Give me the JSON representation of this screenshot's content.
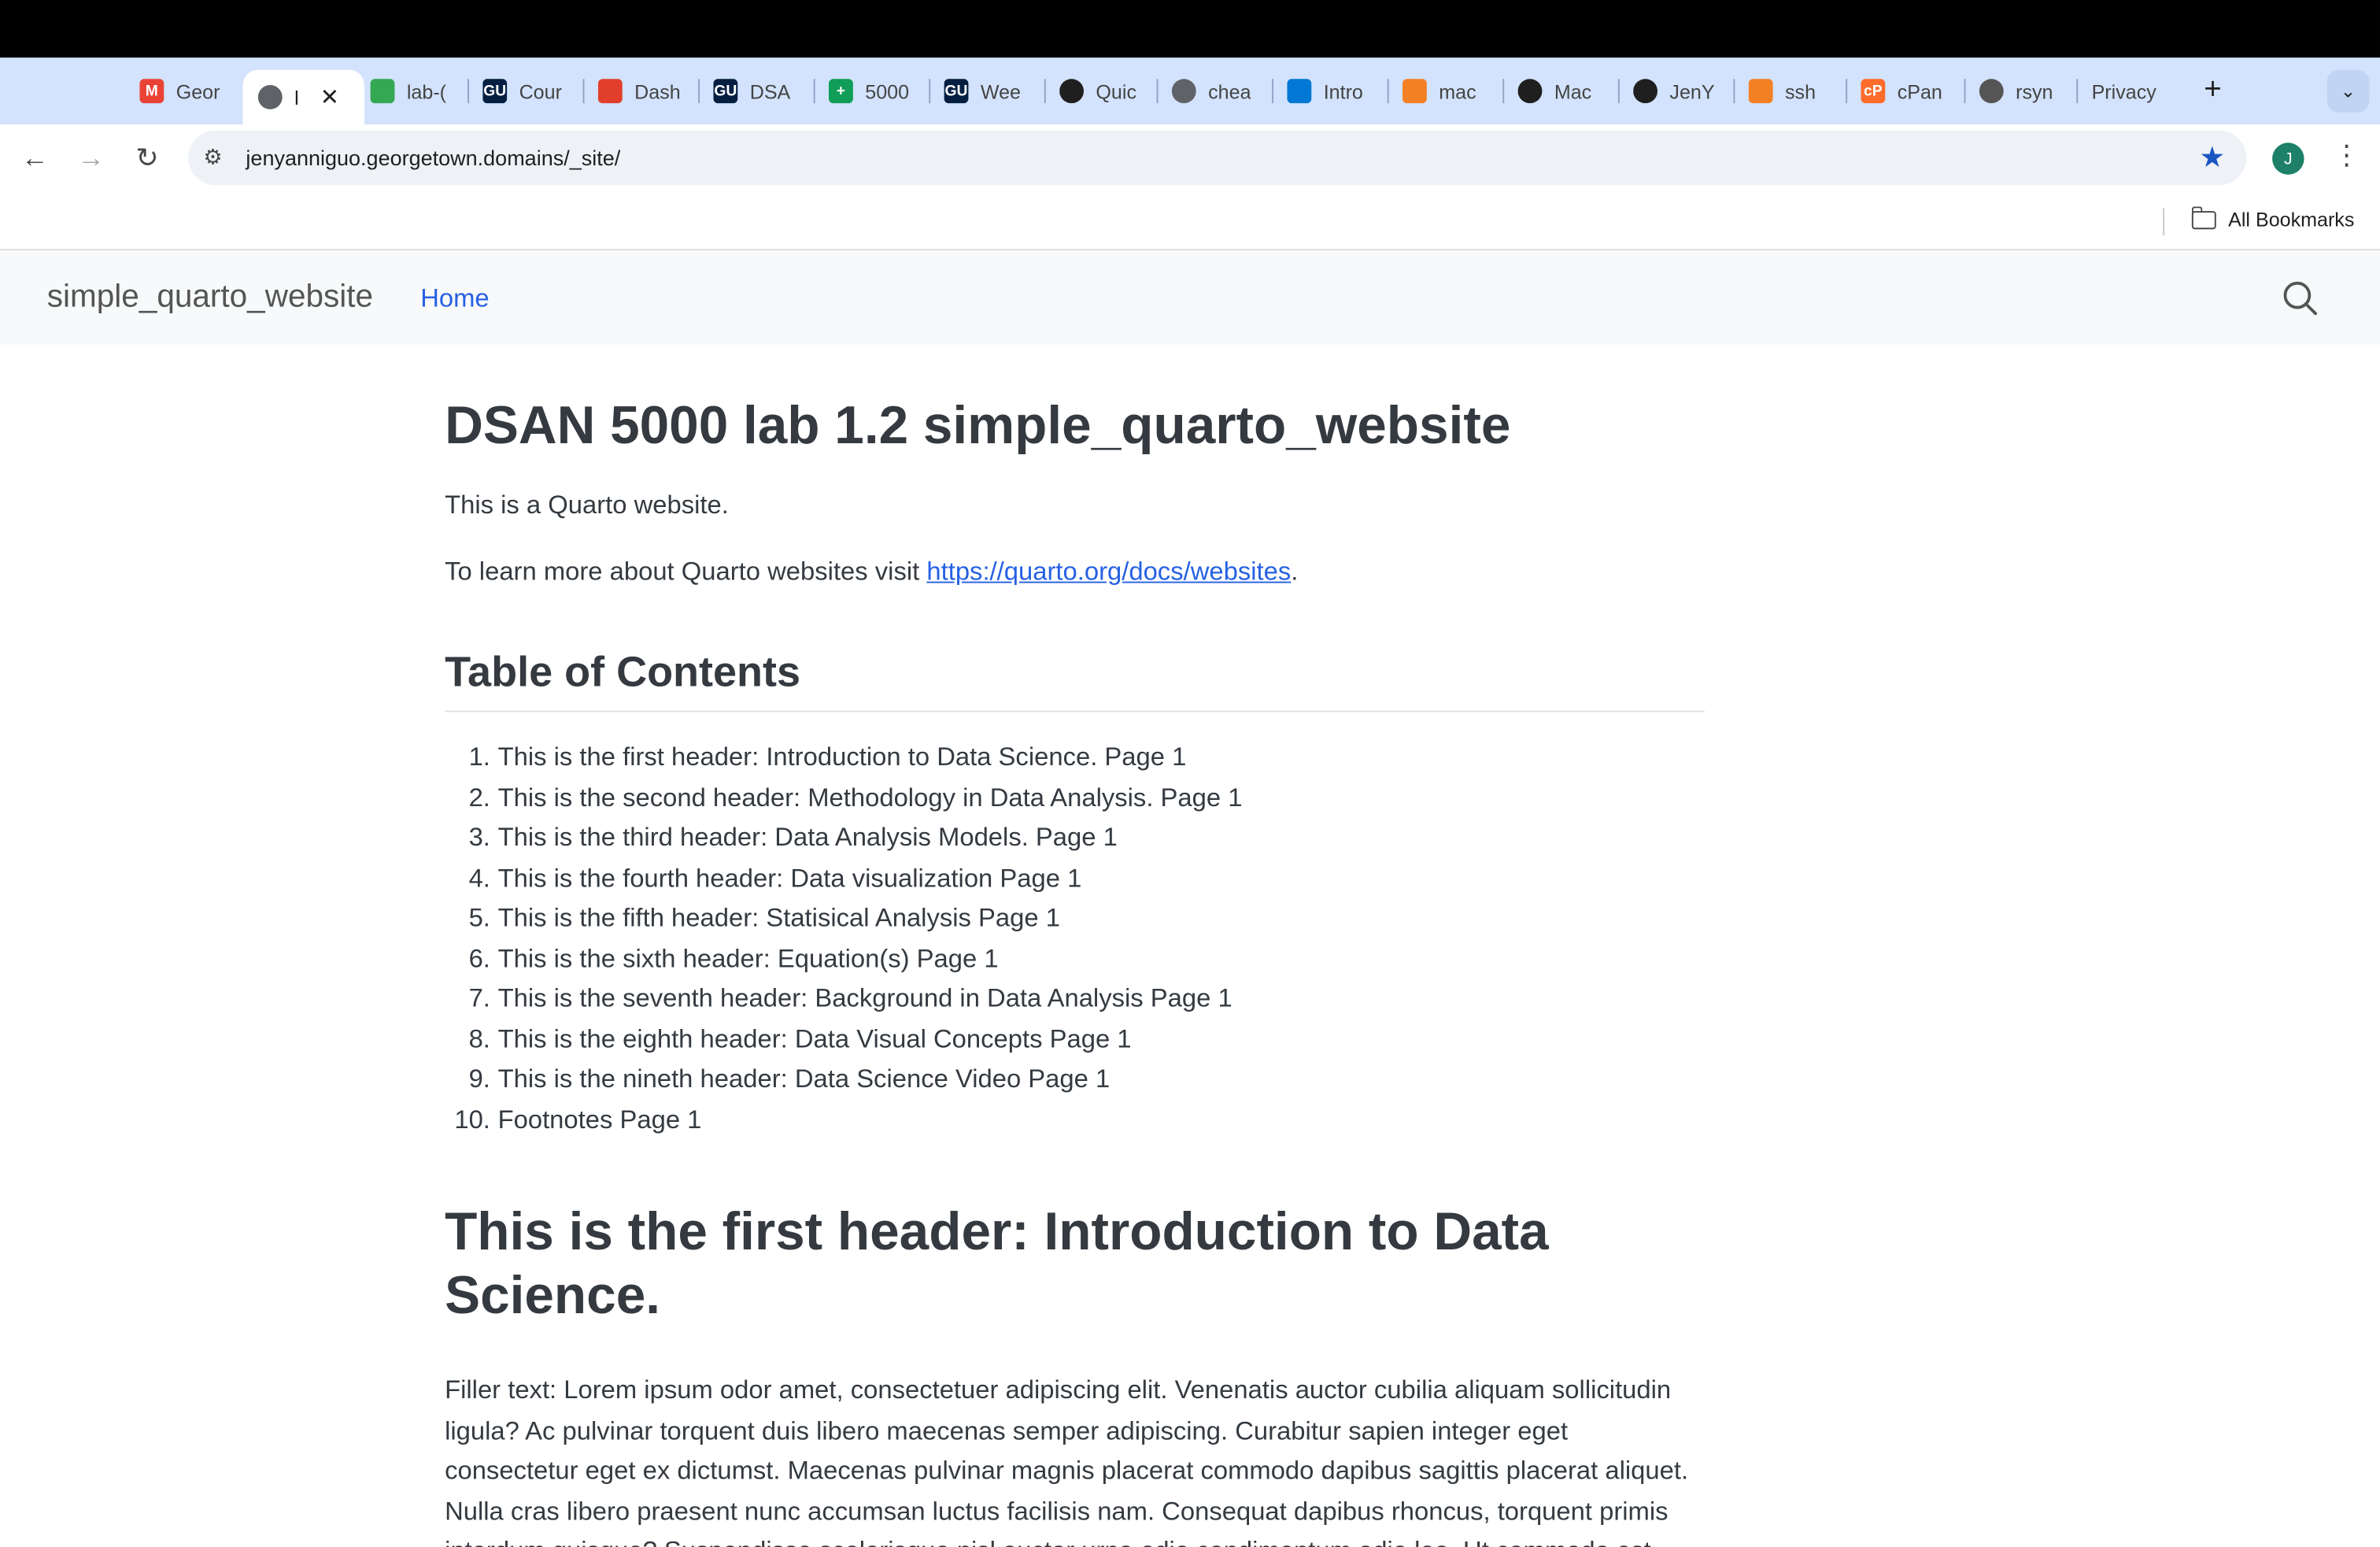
{
  "browser": {
    "tabs": [
      {
        "title": "Geor",
        "icon": "gmail-icon",
        "color": "#ea4335",
        "glyph": "M"
      },
      {
        "title": "l",
        "icon": "globe-icon",
        "color": "#5f6368",
        "glyph": "",
        "active": true
      },
      {
        "title": "lab-(",
        "icon": "google-drive-icon",
        "color": "#34a853",
        "glyph": ""
      },
      {
        "title": "Cour",
        "icon": "georgetown-icon",
        "color": "#041e42",
        "glyph": "GU"
      },
      {
        "title": "Dash",
        "icon": "canvas-icon",
        "color": "#e13f2b",
        "glyph": ""
      },
      {
        "title": "DSA",
        "icon": "georgetown-icon",
        "color": "#041e42",
        "glyph": "GU"
      },
      {
        "title": "5000",
        "icon": "google-sheets-icon",
        "color": "#0f9d58",
        "glyph": "+"
      },
      {
        "title": "Wee",
        "icon": "georgetown-icon",
        "color": "#041e42",
        "glyph": "GU"
      },
      {
        "title": "Quic",
        "icon": "github-icon",
        "color": "#1f1f1f",
        "glyph": ""
      },
      {
        "title": "chea",
        "icon": "globe-icon",
        "color": "#5f6368",
        "glyph": ""
      },
      {
        "title": "Intro",
        "icon": "vscode-icon",
        "color": "#0078d4",
        "glyph": ""
      },
      {
        "title": "mac",
        "icon": "stackoverflow-icon",
        "color": "#f48024",
        "glyph": ""
      },
      {
        "title": "Mac",
        "icon": "github-icon",
        "color": "#1f1f1f",
        "glyph": ""
      },
      {
        "title": "JenY",
        "icon": "github-icon",
        "color": "#1f1f1f",
        "glyph": ""
      },
      {
        "title": "ssh",
        "icon": "stackoverflow-icon",
        "color": "#f48024",
        "glyph": ""
      },
      {
        "title": "cPan",
        "icon": "cpanel-icon",
        "color": "#ff6c2c",
        "glyph": "cP"
      },
      {
        "title": "rsyn",
        "icon": "apple-icon",
        "color": "#555555",
        "glyph": ""
      },
      {
        "title": "Privacy",
        "icon": "none",
        "color": "",
        "glyph": ""
      }
    ],
    "url": "jenyanniguo.georgetown.domains/_site/",
    "avatar_initial": "J",
    "bookmarks_label": "All Bookmarks"
  },
  "site": {
    "brand": "simple_quarto_website",
    "nav_home": "Home",
    "title": "DSAN 5000 lab 1.2 simple_quarto_website",
    "intro": "This is a Quarto website.",
    "learn_prefix": "To learn more about Quarto websites visit ",
    "learn_link": "https://quarto.org/docs/websites",
    "learn_suffix": ".",
    "toc_heading": "Table of Contents",
    "toc": [
      "This is the first header: Introduction to Data Science. Page 1",
      "This is the second header: Methodology in Data Analysis. Page 1",
      "This is the third header: Data Analysis Models. Page 1",
      "This is the fourth header: Data visualization Page 1",
      "This is the fifth header: Statisical Analysis Page 1",
      "This is the sixth header: Equation(s) Page 1",
      "This is the seventh header: Background in Data Analysis Page 1",
      "This is the eighth header: Data Visual Concepts Page 1",
      "This is the nineth header: Data Science Video Page 1",
      "Footnotes Page 1"
    ],
    "section1_heading": "This is the first header: Introduction to Data Science.",
    "section1_text": "Filler text: Lorem ipsum odor amet, consectetuer adipiscing elit. Venenatis auctor cubilia aliquam sollicitudin ligula? Ac pulvinar torquent duis libero maecenas semper adipiscing. Curabitur sapien integer eget consectetur eget ex dictumst. Maecenas pulvinar magnis placerat commodo dapibus sagittis placerat aliquet. Nulla cras libero praesent nunc accumsan luctus facilisis nam. Consequat dapibus rhoncus, torquent primis interdum quisque? Suspendisse scelerisque nisl auctor urna odio condimentum odio leo. Ut commodo est fusce dui lectus conubia auctor."
  }
}
